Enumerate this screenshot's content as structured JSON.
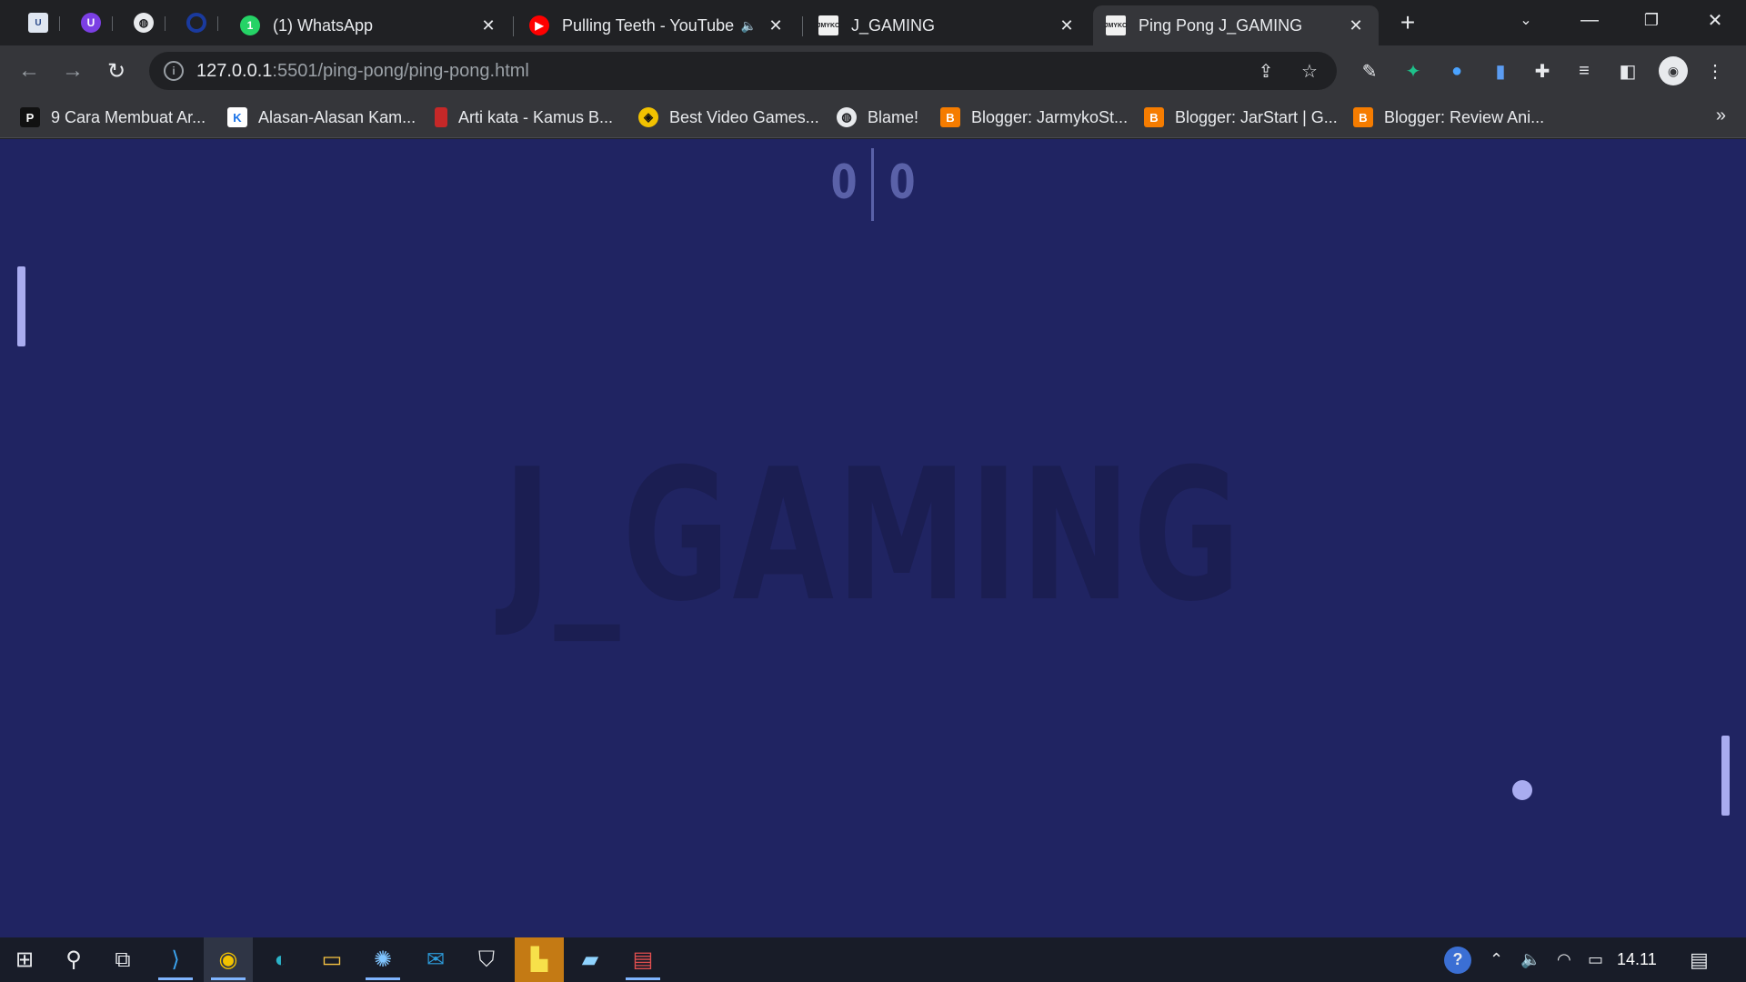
{
  "browser": {
    "pinned_tabs": [
      {
        "icon": "uncase-icon"
      },
      {
        "icon": "u-extension-icon"
      },
      {
        "icon": "globe-icon"
      },
      {
        "icon": "circle-logo-icon"
      }
    ],
    "tabs": [
      {
        "title": "(1) WhatsApp",
        "icon": "whatsapp-icon",
        "badge": "1"
      },
      {
        "title": "Pulling Teeth - YouTube",
        "icon": "youtube-icon"
      },
      {
        "title": "J_GAMING",
        "icon": "jmyko-logo-icon"
      },
      {
        "title": "Ping Pong J_GAMING",
        "icon": "jmyko-logo-icon",
        "active": true
      }
    ],
    "address": {
      "host": "127.0.0.1",
      "path": ":5501/ping-pong/ping-pong.html"
    },
    "bookmarks": [
      {
        "label": "9 Cara Membuat Ar...",
        "icon": "P"
      },
      {
        "label": "Alasan-Alasan Kam...",
        "icon": "K"
      },
      {
        "label": "Arti kata - Kamus B...",
        "icon": "book"
      },
      {
        "label": "Best Video Games...",
        "icon": "cd"
      },
      {
        "label": "Blame!",
        "icon": "globe"
      },
      {
        "label": "Blogger: JarmykoSt...",
        "icon": "B"
      },
      {
        "label": "Blogger: JarStart | G...",
        "icon": "B"
      },
      {
        "label": "Blogger: Review Ani...",
        "icon": "B"
      }
    ],
    "bookmarks_overflow": "»"
  },
  "game": {
    "score_left": "0",
    "score_right": "0",
    "watermark": "J_GAMING",
    "colors": {
      "background": "#202462",
      "paddle": "#a9acf0",
      "score": "#5a61a8",
      "watermark": "#1b1e52"
    }
  },
  "taskbar": {
    "time": "14.11",
    "apps": [
      "windows-start",
      "search",
      "task-view",
      "vscode",
      "chrome",
      "edge",
      "file-explorer",
      "paint",
      "mail",
      "security",
      "sticky-notes",
      "notepad",
      "snipping-tool"
    ]
  }
}
